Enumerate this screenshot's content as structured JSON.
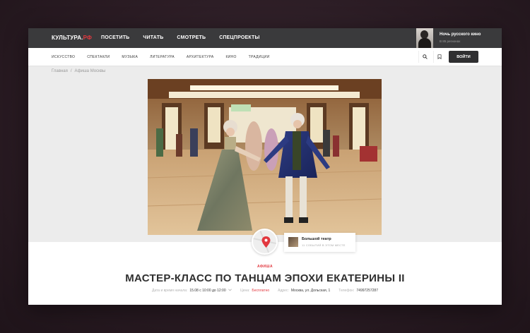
{
  "header": {
    "logo_main": "КУЛЬТУРА.",
    "logo_accent": "РФ",
    "nav": [
      "ПОСЕТИТЬ",
      "ЧИТАТЬ",
      "СМОТРЕТЬ",
      "СПЕЦПРОЕКТЫ"
    ],
    "promo_title": "Ночь русского кино",
    "promo_subtitle": "В 85 регионах"
  },
  "subnav": {
    "items": [
      "ИСКУССТВО",
      "СПЕКТАКЛИ",
      "МУЗЫКА",
      "ЛИТЕРАТУРА",
      "АРХИТЕКТУРА",
      "КИНО",
      "ТРАДИЦИИ"
    ],
    "login_label": "ВОЙТИ"
  },
  "breadcrumb": {
    "home": "Главная",
    "separator": "/",
    "current": "Афиша Москвы"
  },
  "place": {
    "name": "Большой театр",
    "events": "11 СОБЫТИЙ В ЭТОМ МЕСТЕ"
  },
  "event": {
    "category": "АФИША",
    "title": "МАСТЕР-КЛАСС ПО ТАНЦАМ ЭПОХИ ЕКАТЕРИНЫ II",
    "date_label": "Дата и время начала:",
    "date_value": "15.08 с 10:00 до 12:00",
    "price_label": "Цена:",
    "price_value": "Бесплатно",
    "address_label": "Адрес:",
    "address_value": "Москва, ул. Дольская, 1",
    "phone_label": "Телефон:",
    "phone_value": "74997257287"
  },
  "colors": {
    "accent": "#e2383f",
    "topbar": "#3a3a3c",
    "button": "#2f2f31"
  },
  "icons": [
    "search-icon",
    "bookmark-icon",
    "map-pin-icon",
    "chevron-down-icon"
  ]
}
